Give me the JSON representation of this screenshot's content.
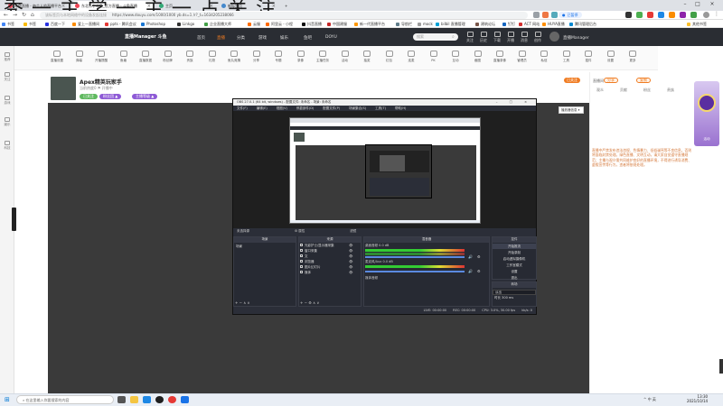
{
  "overlay_text": "秀 一 主 学 一 主 一 占 关 注",
  "browser": {
    "tabs": [
      {
        "label": "斗鱼直播 - 每个人的直播平台",
        "active": false
      },
      {
        "label": "东北乐 | 斗鱼_官方直播 - 斗鱼直播",
        "active": true
      },
      {
        "label": "主页",
        "active": false
      },
      {
        "label": "新标签页",
        "active": false
      }
    ],
    "url": "https://www.douyu.com/1000/1000 yb.ds=1 /r?_t=1634205238066",
    "url_hint": "该标签页与本地网络中的设备发起连接",
    "profile_label": "已暂停",
    "bookmarks": [
      "书签",
      "书签",
      "百度一下",
      "爱上一直播间",
      "ppts - 腾讯会议",
      "Photoshop",
      "Linkgo",
      "企业直播大师",
      "云服",
      "阿里云 - 小程",
      "抖音直播",
      "中国建服",
      "新一代直播平台",
      "导航栏",
      "mock",
      "bilbil 直播管理",
      "建筑论坛",
      "钉钉",
      "ACT 网站",
      "HUYA直播",
      "腾讯管理后台",
      "其他书签"
    ]
  },
  "site": {
    "logo": "直播Manager 斗鱼",
    "nav": [
      "首页",
      "直播",
      "分类",
      "游戏",
      "娱乐",
      "鱼吧",
      "DOYU"
    ],
    "search_placeholder": "搜索",
    "user_name": "直播Manager",
    "header_icons": [
      "关注",
      "历史",
      "下载",
      "开播",
      "消息",
      "创作",
      "任务"
    ],
    "left_rail": [
      "推荐",
      "关注",
      "游戏",
      "娱乐",
      "科技"
    ],
    "toolbar": [
      "直播设置",
      "弹幕",
      "开播提醒",
      "鱼塘",
      "直播数据",
      "粉丝牌",
      "贵族",
      "礼物",
      "鱼丸竞猜",
      "分享",
      "专题",
      "录像",
      "主播任务",
      "活动",
      "抽奖",
      "红包",
      "连麦",
      "PK",
      "互动",
      "截图",
      "直播录像",
      "管理员",
      "私信",
      "工具",
      "插件",
      "设置",
      "更多"
    ],
    "room": {
      "title": "Apex精英玩家手",
      "subtitle": "当前热度0  ⚑  开播中",
      "chips": [
        "已关注",
        "粉丝团 ▲",
        "主播等级 ▲"
      ]
    },
    "right_panel": {
      "title": "直播间",
      "buttons": [
        "已关注",
        "分享",
        "复制"
      ],
      "tabs": [
        "观众",
        "贡献",
        "粉丝",
        "贵族"
      ],
      "note": "直播中严禁发布违法违规、色情暴力、低俗谩骂等不良信息，否则将面临封禁处理。绿色直播、文明互动，请大家自觉遵守直播规范；主播与观众需共同维护良好的直播环境，不得进行诱导消费、虚假宣传等行为，违者将依规处理。"
    },
    "promo_label": "活动"
  },
  "obs": {
    "title": "OBS 27.0.1 (64 bit, windows) - 配置文件: 未命名 - 场景: 未命名",
    "menu": [
      "文件(F)",
      "编辑(E)",
      "视图(V)",
      "停靠部件(D)",
      "配置文件(P)",
      "场景集合(S)",
      "工具(T)",
      "帮助(H)"
    ],
    "float_label": "播放器信息",
    "status_left": "未选择源",
    "status_mid": "⚙ 属性",
    "status_filter": "滤镜",
    "docks": {
      "scenes": {
        "title": "场景",
        "items": [
          "场景"
        ]
      },
      "sources": {
        "title": "来源",
        "items": [
          "光影护士/显示器采集",
          "窗口采集",
          "文",
          "浏览器",
          "图片幻灯片",
          "媒体"
        ]
      },
      "mixer": {
        "title": "混音器",
        "tracks": [
          "桌面音频  0.0 dB",
          "麦克风/Aux  0.0 dB",
          "媒体音频"
        ]
      },
      "transitions": {
        "title": "转场",
        "type": "淡出",
        "duration_label": "时长",
        "duration": "300 ms"
      },
      "controls": {
        "title": "控件",
        "buttons": [
          "开始推流",
          "开始录制",
          "启动虚拟摄像机",
          "工作室模式",
          "设置",
          "退出"
        ]
      }
    },
    "footer": [
      "LIVE: 00:00:00",
      "REC: 00:00:00",
      "CPU: 3.0%, 30.00 fps",
      "kb/s: 0"
    ]
  },
  "taskbar": {
    "search_placeholder": "在这里输入你要搜索的内容",
    "time": "13:30",
    "date": "2021/10/14",
    "tray": "^ 中 英"
  },
  "colors": {
    "site_header": "#2a2d33",
    "obs_bg": "#2b2e38",
    "chip_purple": "#8e5ad6",
    "chip_green": "#5fb95f",
    "accent_orange": "#f07c22",
    "note_orange": "#d4783a"
  }
}
